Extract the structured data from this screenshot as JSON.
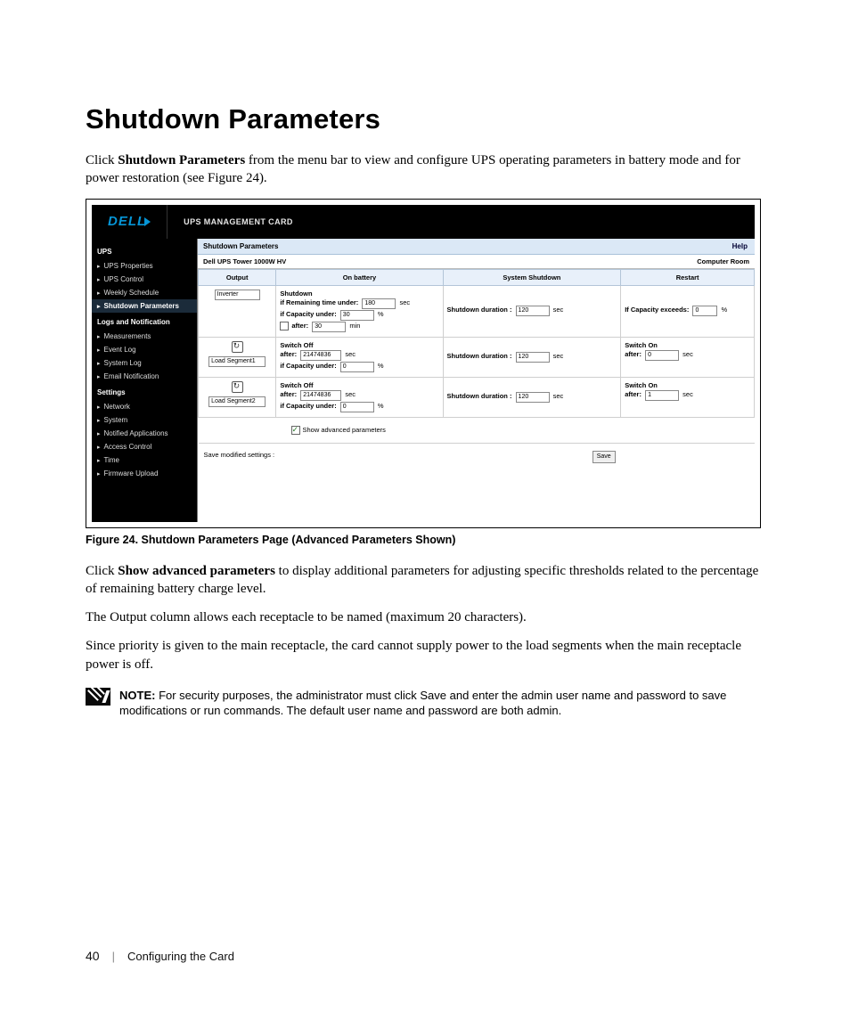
{
  "heading": "Shutdown Parameters",
  "intro": {
    "pre": "Click ",
    "bold": "Shutdown Parameters",
    "post": " from the menu bar to view and configure UPS operating parameters in battery mode and for power restoration (see Figure 24)."
  },
  "figure_caption": "Figure 24. Shutdown Parameters Page (Advanced Parameters Shown)",
  "para_adv": {
    "pre": "Click ",
    "bold": "Show advanced parameters",
    "post": " to display additional parameters for adjusting specific thresholds related to the percentage of remaining battery charge level."
  },
  "para_output": "The Output column allows each receptacle to be named (maximum 20 characters).",
  "para_priority": "Since priority is given to the main receptacle, the card cannot supply power to the load segments when the main receptacle power is off.",
  "note": {
    "label": "NOTE:",
    "text": " For security purposes, the administrator must click Save and enter the admin user name and password to save modifications or run commands. The default user name and password are both admin."
  },
  "footer": {
    "page_number": "40",
    "section": "Configuring the Card"
  },
  "ui": {
    "brand": "DELL",
    "card_title": "UPS MANAGEMENT CARD",
    "nav": {
      "groups": [
        {
          "header": "UPS",
          "items": [
            "UPS Properties",
            "UPS Control",
            "Weekly Schedule",
            "Shutdown Parameters"
          ]
        },
        {
          "header": "Logs and Notification",
          "items": [
            "Measurements",
            "Event Log",
            "System Log",
            "Email Notification"
          ]
        },
        {
          "header": "Settings",
          "items": [
            "Network",
            "System",
            "Notified Applications",
            "Access Control",
            "Time",
            "Firmware Upload"
          ]
        }
      ],
      "active": "Shutdown Parameters"
    },
    "panel": {
      "title": "Shutdown Parameters",
      "help": "Help",
      "device": "Dell UPS Tower 1000W HV",
      "location": "Computer Room",
      "cols": [
        "Output",
        "On battery",
        "System Shutdown",
        "Restart"
      ],
      "rows": [
        {
          "output": {
            "name": "Inverter"
          },
          "onbattery": {
            "title": "Shutdown",
            "l1": "if Remaining time under:",
            "v1": "180",
            "u1": "sec",
            "l2": "if Capacity under:",
            "v2": "30",
            "u2": "%",
            "l3": "after:",
            "v3": "30",
            "u3": "min",
            "l3_chk": false
          },
          "shutdown": {
            "label": "Shutdown duration :",
            "value": "120",
            "unit": "sec"
          },
          "restart": {
            "label": "If Capacity exceeds:",
            "value": "0",
            "unit": "%"
          }
        },
        {
          "output": {
            "name": "Load Segment1",
            "icon": true
          },
          "onbattery": {
            "title": "Switch Off",
            "l1": "after:",
            "v1": "21474836",
            "u1": "sec",
            "l2": "if Capacity under:",
            "v2": "0",
            "u2": "%"
          },
          "shutdown": {
            "label": "Shutdown duration :",
            "value": "120",
            "unit": "sec"
          },
          "restart": {
            "title": "Switch On",
            "label": "after:",
            "value": "0",
            "unit": "sec"
          }
        },
        {
          "output": {
            "name": "Load Segment2",
            "icon": true
          },
          "onbattery": {
            "title": "Switch Off",
            "l1": "after:",
            "v1": "21474836",
            "u1": "sec",
            "l2": "if Capacity under:",
            "v2": "0",
            "u2": "%"
          },
          "shutdown": {
            "label": "Shutdown duration :",
            "value": "120",
            "unit": "sec"
          },
          "restart": {
            "title": "Switch On",
            "label": "after:",
            "value": "1",
            "unit": "sec"
          }
        }
      ],
      "adv_checkbox": "Show advanced parameters",
      "save_label": "Save modified settings :",
      "save_btn": "Save"
    }
  }
}
